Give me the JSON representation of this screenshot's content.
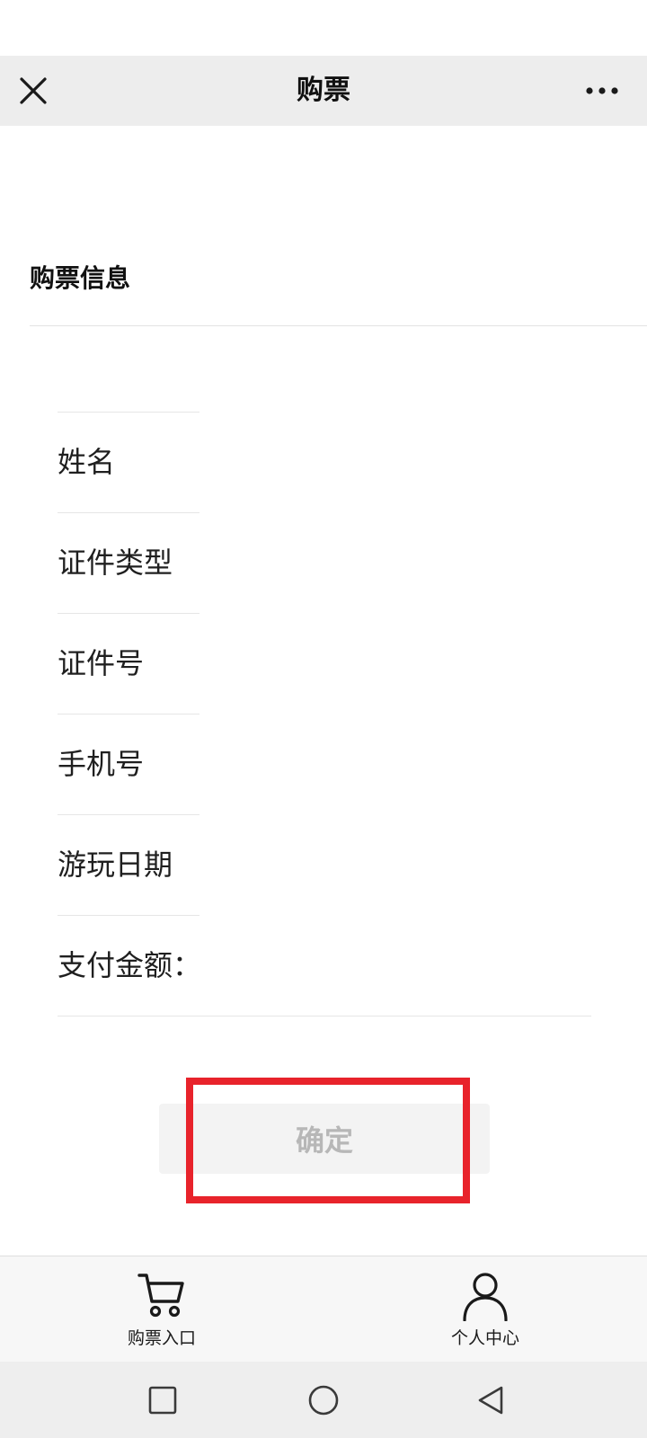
{
  "nav": {
    "title": "购票",
    "close_icon": "close-icon",
    "more_icon": "more-dots-icon"
  },
  "section": {
    "title": "购票信息"
  },
  "form": {
    "fields": [
      {
        "label": "姓名"
      },
      {
        "label": "证件类型"
      },
      {
        "label": "证件号"
      },
      {
        "label": "手机号"
      },
      {
        "label": "游玩日期"
      },
      {
        "label": "支付金额："
      }
    ]
  },
  "confirm": {
    "label": "确定",
    "highlight_color": "#e8232b"
  },
  "tabbar": {
    "items": [
      {
        "label": "购票入口",
        "icon": "cart-icon"
      },
      {
        "label": "个人中心",
        "icon": "person-icon"
      }
    ]
  },
  "system_nav": {
    "icons": [
      "recent-apps-icon",
      "home-icon",
      "back-icon"
    ]
  }
}
